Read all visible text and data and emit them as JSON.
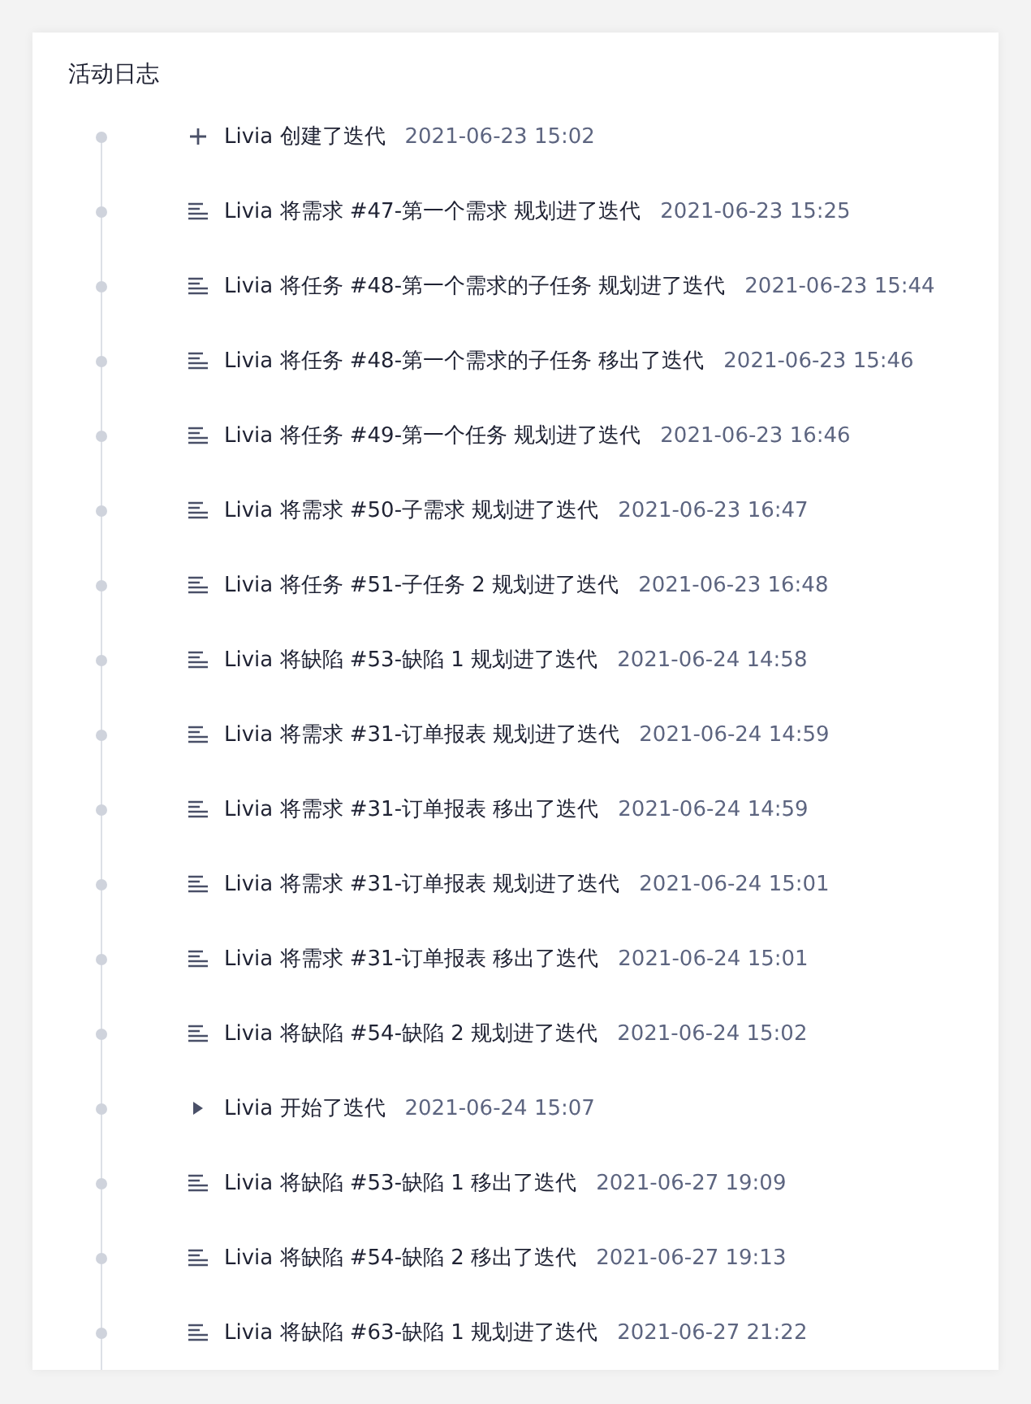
{
  "title": "活动日志",
  "entries": [
    {
      "kind": "create",
      "text": "Livia 创建了迭代",
      "time": "2021-06-23 15:02"
    },
    {
      "kind": "item",
      "text": "Livia 将需求 #47-第一个需求 规划进了迭代",
      "time": "2021-06-23 15:25"
    },
    {
      "kind": "item",
      "text": "Livia 将任务 #48-第一个需求的子任务 规划进了迭代",
      "time": "2021-06-23 15:44"
    },
    {
      "kind": "item",
      "text": "Livia 将任务 #48-第一个需求的子任务 移出了迭代",
      "time": "2021-06-23 15:46"
    },
    {
      "kind": "item",
      "text": "Livia 将任务 #49-第一个任务 规划进了迭代",
      "time": "2021-06-23 16:46"
    },
    {
      "kind": "item",
      "text": "Livia 将需求 #50-子需求 规划进了迭代",
      "time": "2021-06-23 16:47"
    },
    {
      "kind": "item",
      "text": "Livia 将任务 #51-子任务 2 规划进了迭代",
      "time": "2021-06-23 16:48"
    },
    {
      "kind": "item",
      "text": "Livia 将缺陷 #53-缺陷 1 规划进了迭代",
      "time": "2021-06-24 14:58"
    },
    {
      "kind": "item",
      "text": "Livia 将需求 #31-订单报表 规划进了迭代",
      "time": "2021-06-24 14:59"
    },
    {
      "kind": "item",
      "text": "Livia 将需求 #31-订单报表 移出了迭代",
      "time": "2021-06-24 14:59"
    },
    {
      "kind": "item",
      "text": "Livia 将需求 #31-订单报表 规划进了迭代",
      "time": "2021-06-24 15:01"
    },
    {
      "kind": "item",
      "text": "Livia 将需求 #31-订单报表 移出了迭代",
      "time": "2021-06-24 15:01"
    },
    {
      "kind": "item",
      "text": "Livia 将缺陷 #54-缺陷 2 规划进了迭代",
      "time": "2021-06-24 15:02"
    },
    {
      "kind": "start",
      "text": "Livia 开始了迭代",
      "time": "2021-06-24 15:07"
    },
    {
      "kind": "item",
      "text": "Livia 将缺陷 #53-缺陷 1 移出了迭代",
      "time": "2021-06-27 19:09"
    },
    {
      "kind": "item",
      "text": "Livia 将缺陷 #54-缺陷 2 移出了迭代",
      "time": "2021-06-27 19:13"
    },
    {
      "kind": "item",
      "text": "Livia 将缺陷 #63-缺陷 1 规划进了迭代",
      "time": "2021-06-27 21:22"
    }
  ]
}
